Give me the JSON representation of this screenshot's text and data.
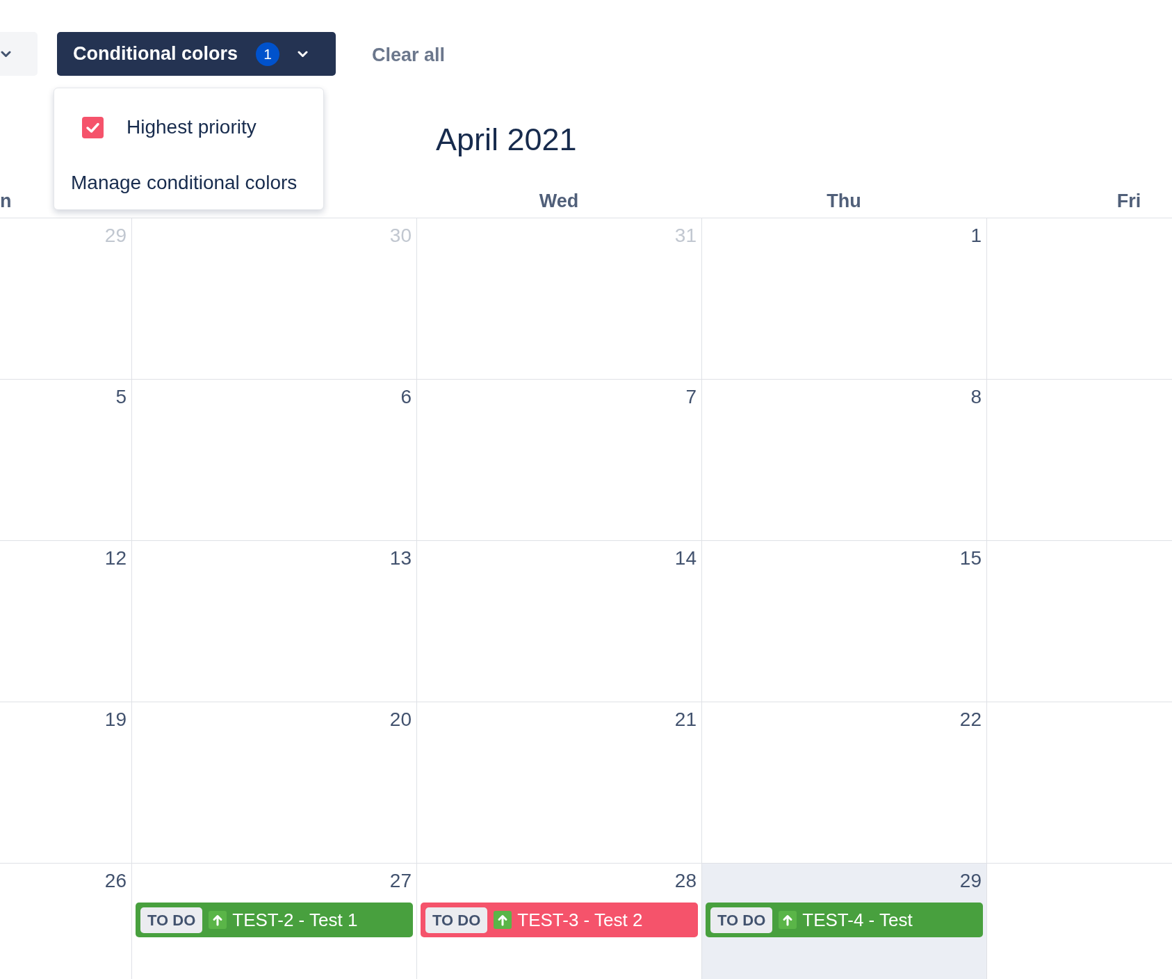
{
  "toolbar": {
    "conditional_colors": {
      "label": "Conditional colors",
      "badge": "1",
      "open": true
    },
    "clear_all": "Clear all"
  },
  "conditional_colors_menu": {
    "rules": [
      {
        "label": "Highest priority",
        "checked": true,
        "color": "#f5536b"
      }
    ],
    "manage_link": "Manage conditional colors"
  },
  "calendar": {
    "title": "April 2021",
    "columns": [
      {
        "header": "n"
      },
      {},
      {
        "header": "Wed"
      },
      {
        "header": "Thu"
      },
      {
        "header": "Fri"
      }
    ],
    "weeks": [
      {
        "days": [
          {
            "date": "29",
            "in_month": false,
            "today": false
          },
          {
            "date": "30",
            "in_month": false,
            "today": false
          },
          {
            "date": "31",
            "in_month": false,
            "today": false
          },
          {
            "date": "1",
            "in_month": true,
            "today": false
          }
        ]
      },
      {
        "days": [
          {
            "date": "5",
            "in_month": true,
            "today": false
          },
          {
            "date": "6",
            "in_month": true,
            "today": false
          },
          {
            "date": "7",
            "in_month": true,
            "today": false
          },
          {
            "date": "8",
            "in_month": true,
            "today": false
          }
        ]
      },
      {
        "days": [
          {
            "date": "12",
            "in_month": true,
            "today": false
          },
          {
            "date": "13",
            "in_month": true,
            "today": false
          },
          {
            "date": "14",
            "in_month": true,
            "today": false
          },
          {
            "date": "15",
            "in_month": true,
            "today": false
          }
        ]
      },
      {
        "days": [
          {
            "date": "19",
            "in_month": true,
            "today": false
          },
          {
            "date": "20",
            "in_month": true,
            "today": false
          },
          {
            "date": "21",
            "in_month": true,
            "today": false
          },
          {
            "date": "22",
            "in_month": true,
            "today": false
          }
        ]
      },
      {
        "days": [
          {
            "date": "26",
            "in_month": true,
            "today": false
          },
          {
            "date": "27",
            "in_month": true,
            "today": false,
            "events": [
              {
                "status": "TO DO",
                "title": "TEST-2 - Test 1",
                "color": "#48a03e"
              }
            ]
          },
          {
            "date": "28",
            "in_month": true,
            "today": false,
            "events": [
              {
                "status": "TO DO",
                "title": "TEST-3 - Test 2",
                "color": "#f5536b"
              }
            ]
          },
          {
            "date": "29",
            "in_month": true,
            "today": true,
            "events": [
              {
                "status": "TO DO",
                "title": "TEST-4 - Test",
                "color": "#48a03e"
              }
            ]
          }
        ]
      }
    ]
  }
}
